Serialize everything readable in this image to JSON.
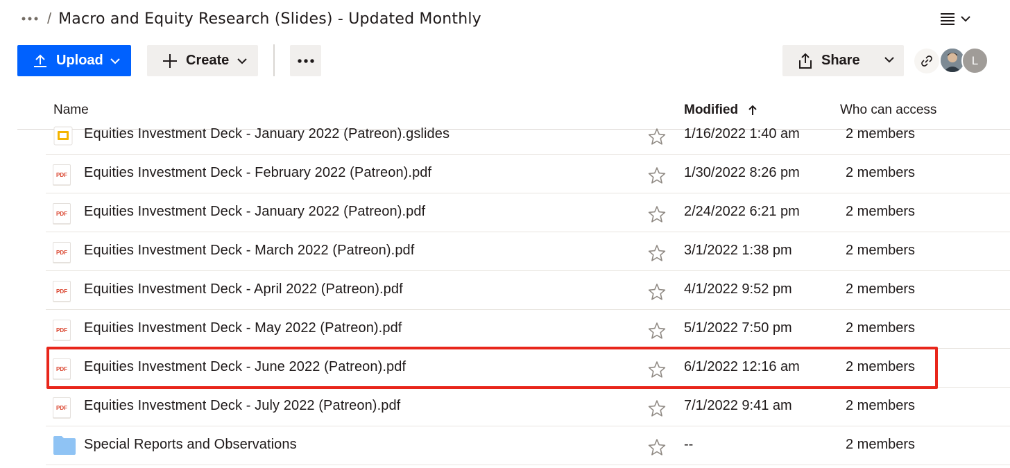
{
  "breadcrumb": {
    "separator": "/",
    "title": "Macro and Equity Research (Slides) - Updated Monthly"
  },
  "toolbar": {
    "upload_label": "Upload",
    "create_label": "Create",
    "share_label": "Share",
    "avatar_initial": "L"
  },
  "table": {
    "headers": {
      "name": "Name",
      "modified": "Modified",
      "access": "Who can access"
    },
    "rows": [
      {
        "icon": "google-slides-icon",
        "name": "Equities Investment Deck - January 2022 (Patreon).gslides",
        "modified": "1/16/2022 1:40 am",
        "access": "2 members"
      },
      {
        "icon": "pdf-icon",
        "icon_text": "PDF",
        "name": "Equities Investment Deck - February 2022 (Patreon).pdf",
        "modified": "1/30/2022 8:26 pm",
        "access": "2 members"
      },
      {
        "icon": "pdf-icon",
        "icon_text": "PDF",
        "name": "Equities Investment Deck - January 2022 (Patreon).pdf",
        "modified": "2/24/2022 6:21 pm",
        "access": "2 members"
      },
      {
        "icon": "pdf-icon",
        "icon_text": "PDF",
        "name": "Equities Investment Deck - March 2022 (Patreon).pdf",
        "modified": "3/1/2022 1:38 pm",
        "access": "2 members"
      },
      {
        "icon": "pdf-icon",
        "icon_text": "PDF",
        "name": "Equities Investment Deck - April 2022 (Patreon).pdf",
        "modified": "4/1/2022 9:52 pm",
        "access": "2 members"
      },
      {
        "icon": "pdf-icon",
        "icon_text": "PDF",
        "name": "Equities Investment Deck - May 2022 (Patreon).pdf",
        "modified": "5/1/2022 7:50 pm",
        "access": "2 members"
      },
      {
        "icon": "pdf-icon",
        "icon_text": "PDF",
        "name": "Equities Investment Deck - June 2022 (Patreon).pdf",
        "modified": "6/1/2022 12:16 am",
        "access": "2 members",
        "highlighted": true
      },
      {
        "icon": "pdf-icon",
        "icon_text": "PDF",
        "name": "Equities Investment Deck - July 2022 (Patreon).pdf",
        "modified": "7/1/2022 9:41 am",
        "access": "2 members"
      },
      {
        "icon": "folder-icon",
        "name": "Special Reports and Observations",
        "modified": "--",
        "access": "2 members"
      }
    ]
  },
  "colors": {
    "primary_blue": "#0061fe",
    "highlight_red": "#e8261b",
    "pdf_red": "#d9412a",
    "folder_blue": "#8fc3f4",
    "slides_yellow": "#f4b400"
  }
}
